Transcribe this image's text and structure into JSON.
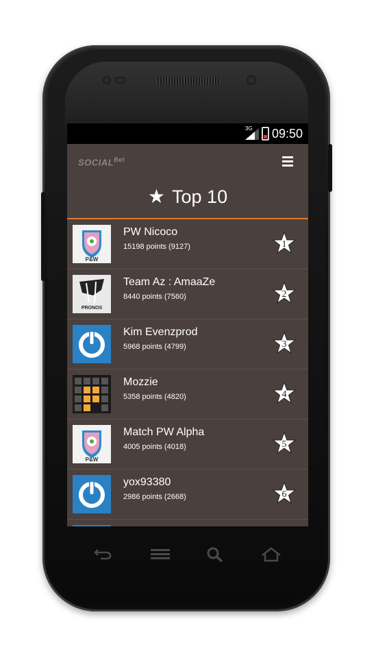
{
  "statusbar": {
    "time": "09:50",
    "network": "3G"
  },
  "app": {
    "logo": "SOCIAL",
    "logo_sup": "Bet",
    "title": "Top 10"
  },
  "players": [
    {
      "name": "PW Nicoco",
      "points": "15198 points (9127)",
      "rank": "1",
      "avatar": "shield-logo"
    },
    {
      "name": "Team Az :  AmaaZe",
      "points": "8440 points (7560)",
      "rank": "2",
      "avatar": "pronos-logo"
    },
    {
      "name": "Kim Evenzprod",
      "points": "5968 points (4799)",
      "rank": "3",
      "avatar": "power-icon"
    },
    {
      "name": "Mozzie",
      "points": "5358 points (4820)",
      "rank": "4",
      "avatar": "grid-pads"
    },
    {
      "name": "Match PW Alpha",
      "points": "4005 points (4018)",
      "rank": "5",
      "avatar": "shield-logo"
    },
    {
      "name": "yox93380",
      "points": "2986 points (2668)",
      "rank": "6",
      "avatar": "power-icon"
    }
  ],
  "colors": {
    "accent": "#e07a2e",
    "screen_bg": "#4a403e",
    "power_blue": "#2a82c4"
  }
}
